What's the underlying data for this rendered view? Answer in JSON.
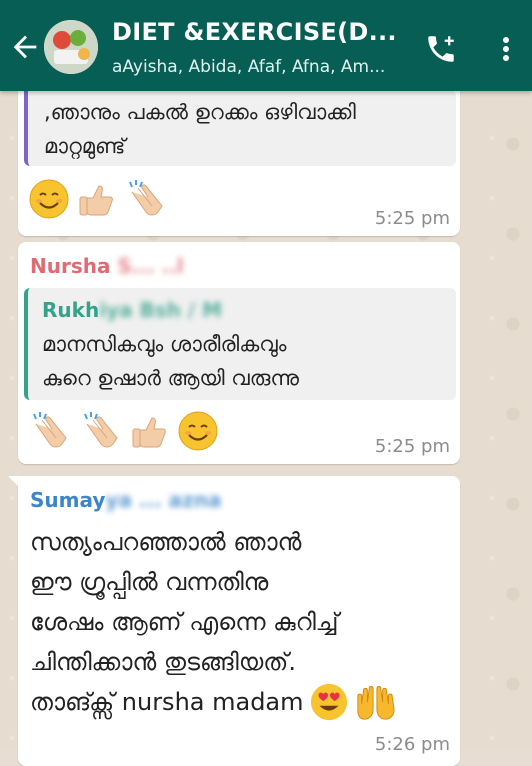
{
  "header": {
    "title": "DIET &EXERCISE(D...",
    "subtitle": "aAyisha, Abida, Afaf, Afna, Am...",
    "icons": [
      "back-arrow-icon",
      "group-avatar",
      "add-call-icon",
      "more-vert-icon"
    ]
  },
  "colors": {
    "appbar": "#075e54",
    "sender_nursha": "#e06b73",
    "sender_rukhiya": "#35a28a",
    "sender_sumay": "#3a86c8",
    "quote_bar_1": "#7f66c4",
    "quote_bar_2": "#35a28a"
  },
  "messages": [
    {
      "quote_lines": [
        ",ഞാനും പകൽ ഉറക്കം ഒഴിവാക്കി",
        "മാറ്റമുണ്ട്"
      ],
      "emojis": [
        "smiling-face-icon",
        "thumbs-up-icon",
        "clapping-hands-icon"
      ],
      "time": "5:25 pm"
    },
    {
      "sender": "Nursha",
      "sender_blurred": "S... ..l",
      "quote_sender": "Rukh",
      "quote_sender_blurred": "iya Bsh / M",
      "quote_lines": [
        "മാനസികവും ശാരീരികവും",
        "കുറെ ഉഷാർ ആയി വരുന്നു"
      ],
      "emojis": [
        "clapping-hands-icon",
        "clapping-hands-icon",
        "thumbs-up-icon",
        "smiling-face-icon"
      ],
      "time": "5:25 pm"
    },
    {
      "sender": "Sumay",
      "sender_blurred": "ya ... azna",
      "lines": [
        "സത്യംപറഞ്ഞാൽ ഞാൻ",
        "ഈ ഗ്രൂപ്പിൽ വന്നതിനു",
        "ശേഷം ആണ് എന്നെ കുറിച്ച്",
        "ചിന്തിക്കാൻ തുടങ്ങിയത്.",
        "താങ്ക്സ് nursha madam"
      ],
      "emojis": [
        "heart-eyes-icon",
        "open-hands-icon"
      ],
      "time": "5:26 pm"
    }
  ]
}
